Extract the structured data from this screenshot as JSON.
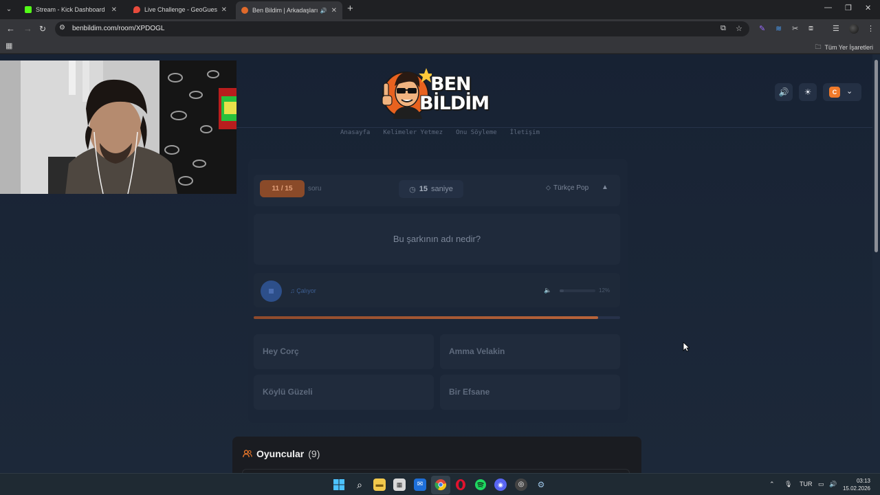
{
  "browser": {
    "tabs": [
      {
        "title": "Stream - Kick Dashboard",
        "favicon_color": "#53fc18",
        "active": false
      },
      {
        "title": "Live Challenge - GeoGuessr",
        "favicon_color": "#e84b3c",
        "active": false
      },
      {
        "title": "Ben Bildim | Arkadaşlarınla",
        "favicon_color": "#e06a2b",
        "active": true
      }
    ],
    "url": "benbildim.com/room/XPDOGL",
    "bookmarks_all_label": "Tüm Yer İşaretleri"
  },
  "site": {
    "logo_line1": "BEN",
    "logo_line2": "BİLDİM",
    "nav": [
      "Anasayfa",
      "Kelimeler Yetmez",
      "Onu Söyleme",
      "İletişim"
    ],
    "user_initial": "C"
  },
  "quiz": {
    "question_counter": "11 / 15",
    "question_word": "soru",
    "timer_value": "15",
    "timer_unit": "saniye",
    "category": "Türkçe Pop",
    "question": "Bu şarkının adı nedir?",
    "playing_label": "Çalıyor",
    "volume_percent": 12,
    "volume_label": "12%",
    "time_progress": 0.94,
    "answers": [
      "Hey Corç",
      "Amma Velakin",
      "Köylü Güzeli",
      "Bir Efsane"
    ]
  },
  "players": {
    "title": "Oyuncular",
    "count": "(9)"
  },
  "taskbar": {
    "language": "TUR",
    "time": "03:13",
    "date": "15.02.2026"
  },
  "colors": {
    "accent": "#f07a2a",
    "page_bg": "#1a2536",
    "card_bg": "#1f2a3b"
  }
}
